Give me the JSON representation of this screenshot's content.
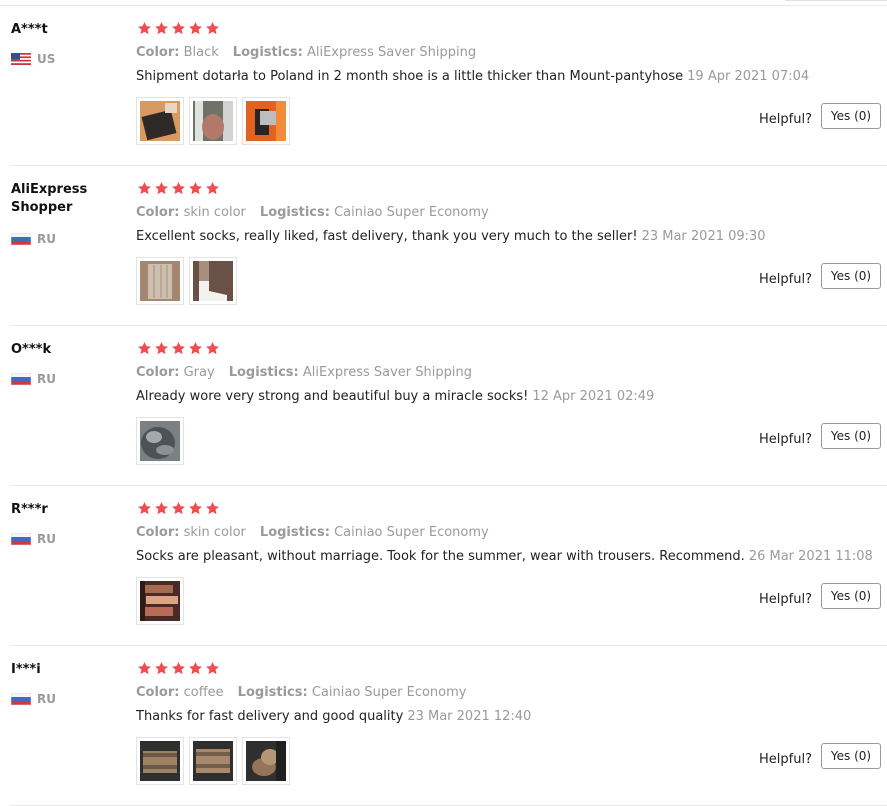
{
  "labels": {
    "color_key": "Color:",
    "logistics_key": "Logistics:",
    "helpful": "Helpful?",
    "yes_button": "Yes (0)"
  },
  "reviews": [
    {
      "user": "A***t",
      "country": "US",
      "flag": "us-flag",
      "rating": 5,
      "color": "Black",
      "logistics": "AliExpress Saver Shipping",
      "text": "Shipment dotarła to Poland in 2 month shoe is a little thicker than Mount-pantyhose",
      "date": "19 Apr 2021 07:04",
      "photos": 3
    },
    {
      "user": "AliExpress Shopper",
      "country": "RU",
      "flag": "ru-flag",
      "rating": 5,
      "color": "skin color",
      "logistics": "Cainiao Super Economy",
      "text": "Excellent socks, really liked, fast delivery, thank you very much to the seller!",
      "date": "23 Mar 2021 09:30",
      "photos": 2
    },
    {
      "user": "O***k",
      "country": "RU",
      "flag": "ru-flag",
      "rating": 5,
      "color": "Gray",
      "logistics": "AliExpress Saver Shipping",
      "text": "Already wore very strong and beautiful buy a miracle socks!",
      "date": "12 Apr 2021 02:49",
      "photos": 1
    },
    {
      "user": "R***r",
      "country": "RU",
      "flag": "ru-flag",
      "rating": 5,
      "color": "skin color",
      "logistics": "Cainiao Super Economy",
      "text": "Socks are pleasant, without marriage. Took for the summer, wear with trousers. Recommend.",
      "date": "26 Mar 2021 11:08",
      "photos": 1
    },
    {
      "user": "I***i",
      "country": "RU",
      "flag": "ru-flag",
      "rating": 5,
      "color": "coffee",
      "logistics": "Cainiao Super Economy",
      "text": "Thanks for fast delivery and good quality",
      "date": "23 Mar 2021 12:40",
      "photos": 3
    }
  ],
  "colors": {
    "star": "#f04d4d",
    "muted_text": "#9a9a9a",
    "button_border": "#999999"
  }
}
